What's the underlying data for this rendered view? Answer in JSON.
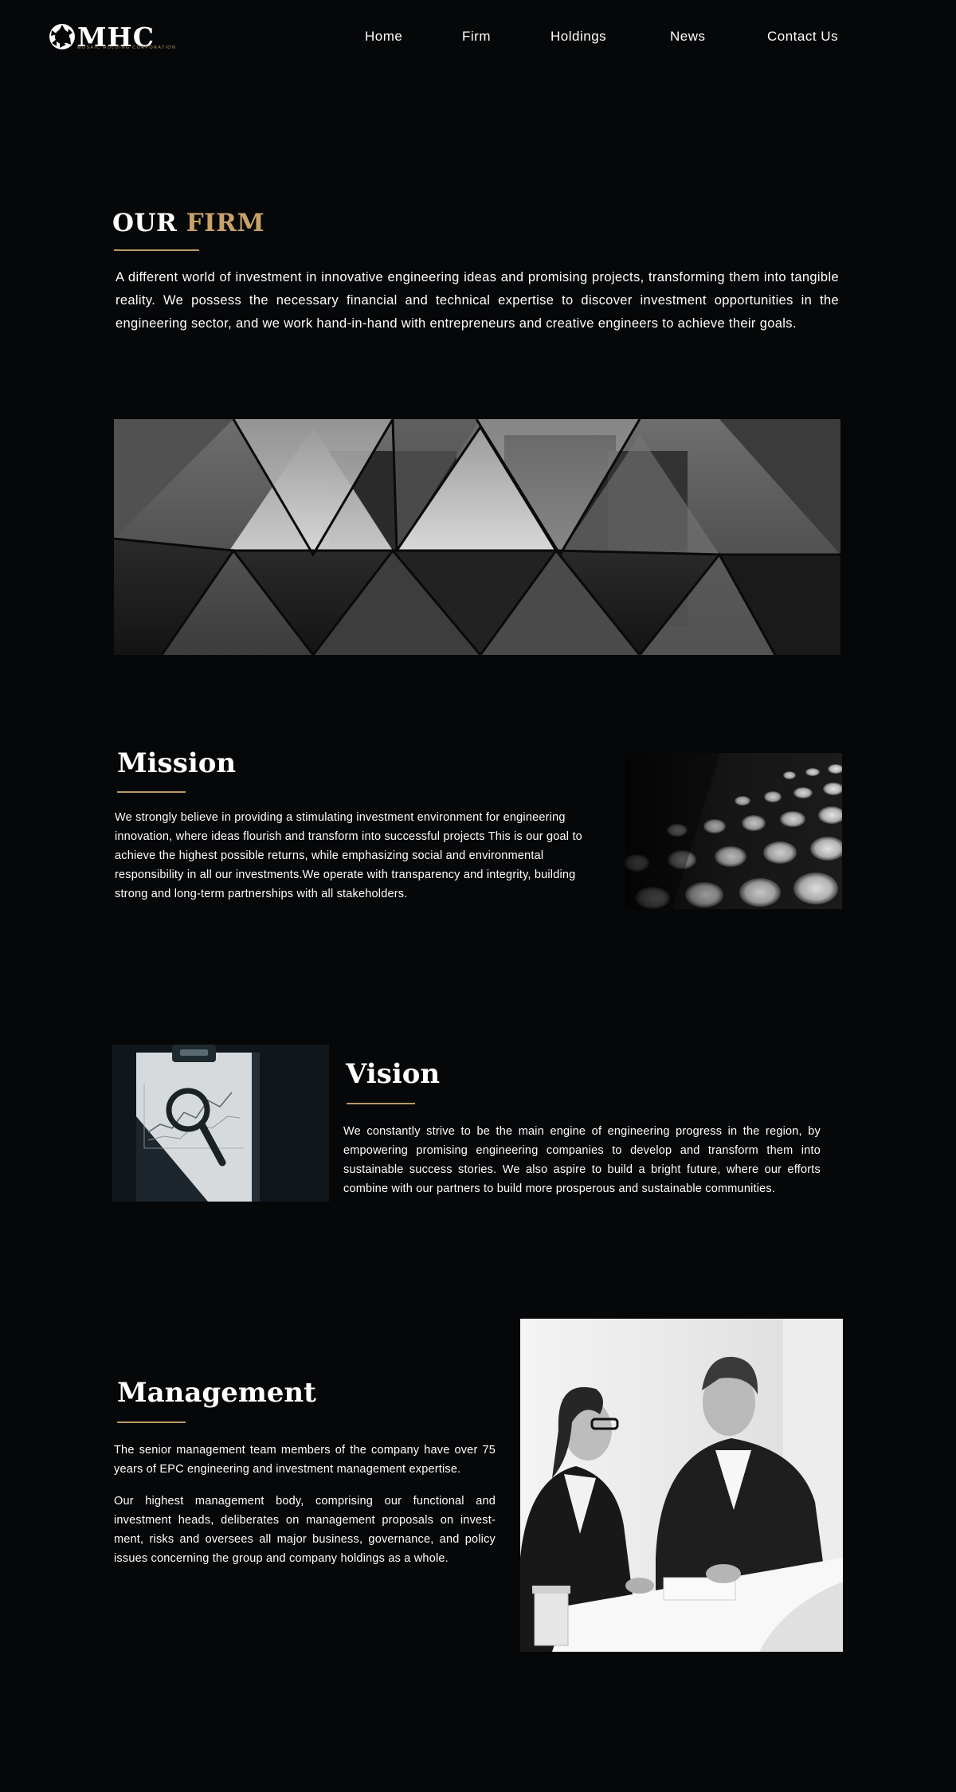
{
  "brand": {
    "name": "MHC",
    "tagline": "MOSAIC HOLDING CORPORATION",
    "accent_color": "#b99a63"
  },
  "nav": {
    "items": [
      "Home",
      "Firm",
      "Holdings",
      "News",
      "Contact Us"
    ]
  },
  "firm": {
    "title_part1": "OUR",
    "title_part2": "FIRM",
    "text": "A different world of investment in innovative engineering ideas and promising projects, transforming them into tangible reality. We possess the necessary financial and technical expertise to discover investment opportunities in the engineering sector, and we work hand-in-hand with entrepreneurs and creative engineers to achieve their goals."
  },
  "mission": {
    "title": "Mission",
    "text": "We strongly believe in providing a stimulating investment environment for engineering innovation, where ideas flourish and transform into successful projects This is our goal to achieve the highest possible returns, while emphasizing social and environmental responsibility in all our investments.We operate with transparency and integrity, building strong and long-term partnerships with all stakeholders."
  },
  "vision": {
    "title": "Vision",
    "text": "We constantly strive to be the main engine of engineering progress in the region, by empowering promising engineering companies to develop and transform them into sustainable success stories. We also aspire to build a bright future, where our efforts combine with our partners to build more prosperous and sustainable communities."
  },
  "management": {
    "title": "Management",
    "paragraph1": "The senior management team members of the company have over 75 years of EPC engineering and investment management expertise.",
    "paragraph2": "Our highest management body, comprising our functional and investment heads, deliberates on management proposals on invest-ment, risks and oversees all major business, governance, and policy issues concerning the group and company holdings as a whole."
  },
  "images": {
    "hero": "glass-triangle-canopy-photo",
    "mission": "perforated-wall-photo",
    "vision": "clipboard-magnifier-chart-photo",
    "management": "business-meeting-photo"
  }
}
